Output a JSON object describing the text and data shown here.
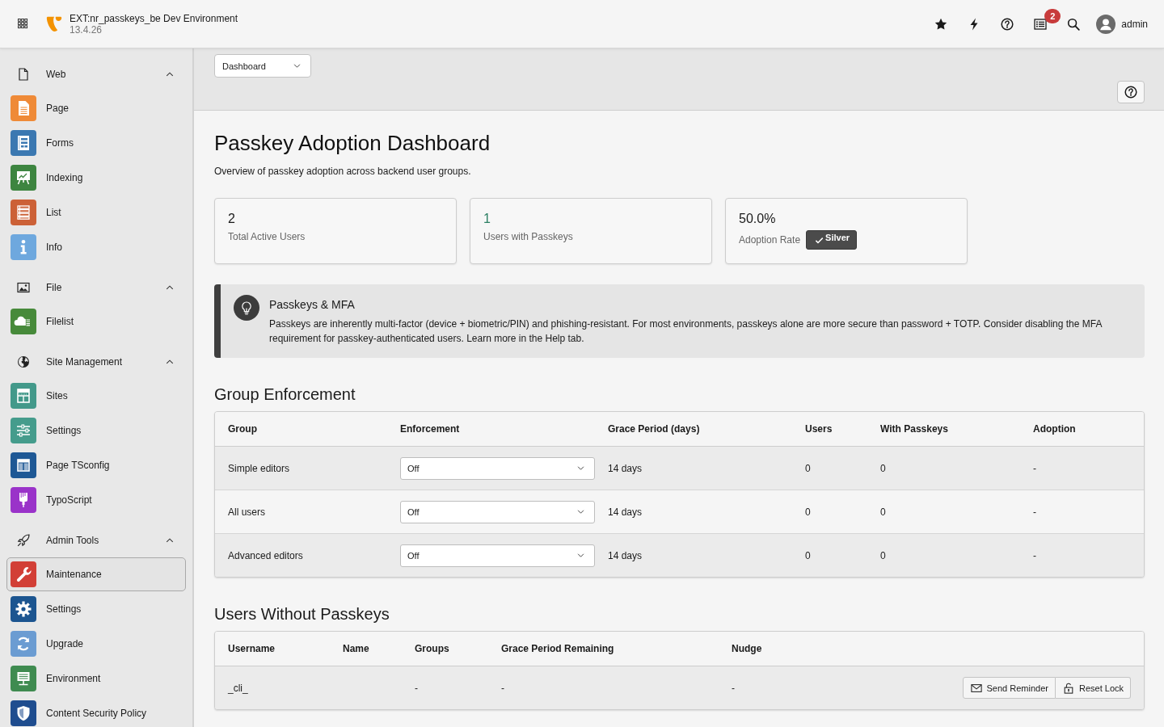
{
  "topbar": {
    "site_title": "EXT:nr_passkeys_be Dev Environment",
    "version": "13.4.26",
    "notification_count": "2",
    "user": "admin"
  },
  "sidebar": {
    "groups": [
      {
        "label": "Web",
        "expanded": true,
        "items": [
          {
            "label": "Page",
            "selected": false,
            "color": "#ef8a37"
          },
          {
            "label": "Forms",
            "selected": false,
            "color": "#3b78b1"
          },
          {
            "label": "Indexing",
            "selected": false,
            "color": "#3d8540"
          },
          {
            "label": "List",
            "selected": false,
            "color": "#cc6137"
          },
          {
            "label": "Info",
            "selected": false,
            "color": "#6ea8de"
          }
        ]
      },
      {
        "label": "File",
        "expanded": true,
        "items": [
          {
            "label": "Filelist",
            "selected": false,
            "color": "#478a3a"
          }
        ]
      },
      {
        "label": "Site Management",
        "expanded": true,
        "items": [
          {
            "label": "Sites",
            "selected": false,
            "color": "#43998a"
          },
          {
            "label": "Settings",
            "selected": false,
            "color": "#459c8c"
          },
          {
            "label": "Page TSconfig",
            "selected": false,
            "color": "#1e5895"
          },
          {
            "label": "TypoScript",
            "selected": false,
            "color": "#9a33c9"
          }
        ]
      },
      {
        "label": "Admin Tools",
        "expanded": true,
        "items": [
          {
            "label": "Maintenance",
            "selected": true,
            "color": "#d23f36"
          },
          {
            "label": "Settings",
            "selected": false,
            "color": "#1c5590"
          },
          {
            "label": "Upgrade",
            "selected": false,
            "color": "#6b9cd2"
          },
          {
            "label": "Environment",
            "selected": false,
            "color": "#3f8b50"
          },
          {
            "label": "Content Security Policy",
            "selected": false,
            "color": "#1f4d8f"
          }
        ]
      }
    ]
  },
  "module_header": {
    "module_select": "Dashboard"
  },
  "page": {
    "title": "Passkey Adoption Dashboard",
    "description": "Overview of passkey adoption across backend user groups."
  },
  "stats": [
    {
      "value": "2",
      "label": "Total Active Users",
      "color": "#1a1a1a"
    },
    {
      "value": "1",
      "label": "Users with Passkeys",
      "color": "#2a7f62"
    },
    {
      "value": "50.0%",
      "label": "Adoption Rate",
      "color": "#1a1a1a",
      "badge": "Silver"
    }
  ],
  "callout": {
    "title": "Passkeys & MFA",
    "text": "Passkeys are inherently multi-factor (device + biometric/PIN) and phishing-resistant. For most environments, passkeys alone are more secure than password + TOTP. Consider disabling the MFA requirement for passkey-authenticated users. Learn more in the Help tab."
  },
  "group_enforcement": {
    "heading": "Group Enforcement",
    "columns": [
      "Group",
      "Enforcement",
      "Grace Period (days)",
      "Users",
      "With Passkeys",
      "Adoption"
    ],
    "rows": [
      {
        "group": "Simple editors",
        "enforcement": "Off",
        "grace_period": "14 days",
        "users": "0",
        "with_passkeys": "0",
        "adoption": "-"
      },
      {
        "group": "All users",
        "enforcement": "Off",
        "grace_period": "14 days",
        "users": "0",
        "with_passkeys": "0",
        "adoption": "-"
      },
      {
        "group": "Advanced editors",
        "enforcement": "Off",
        "grace_period": "14 days",
        "users": "0",
        "with_passkeys": "0",
        "adoption": "-"
      }
    ]
  },
  "users_without_passkeys": {
    "heading": "Users Without Passkeys",
    "columns": [
      "Username",
      "Name",
      "Groups",
      "Grace Period Remaining",
      "Nudge"
    ],
    "rows": [
      {
        "username": "_cli_",
        "groups": "-",
        "grace_period_remaining": "-",
        "nudge": "-",
        "actions": [
          {
            "kind": "reminder",
            "label": "Send Reminder"
          },
          {
            "kind": "unlock",
            "label": "Reset Lock"
          }
        ]
      }
    ]
  }
}
